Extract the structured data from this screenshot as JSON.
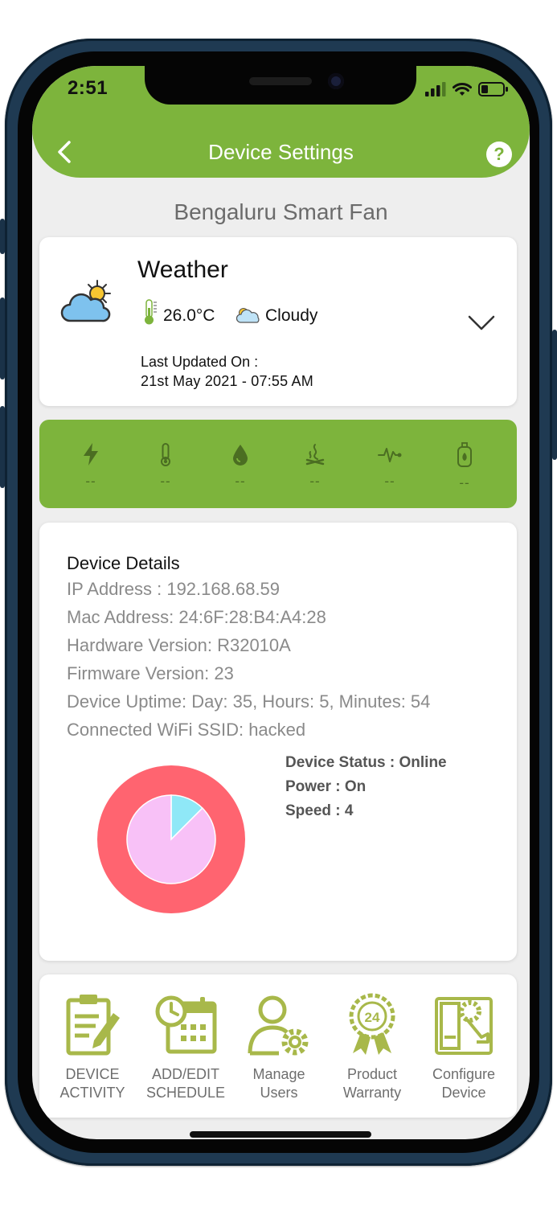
{
  "status_bar": {
    "time": "2:51"
  },
  "header": {
    "title": "Device Settings",
    "help_label": "?"
  },
  "device": {
    "name": "Bengaluru Smart Fan"
  },
  "weather": {
    "title": "Weather",
    "temperature": "26.0°C",
    "condition": "Cloudy",
    "last_updated_label": "Last Updated On :",
    "last_updated_value": "21st May 2021 - 07:55 AM"
  },
  "sensors": [
    {
      "icon": "bolt-icon",
      "value": "--"
    },
    {
      "icon": "thermometer-icon",
      "value": "--"
    },
    {
      "icon": "water-drop-icon",
      "value": "--"
    },
    {
      "icon": "smoke-icon",
      "value": "--"
    },
    {
      "icon": "pulse-icon",
      "value": "--"
    },
    {
      "icon": "gas-cylinder-icon",
      "value": "--"
    }
  ],
  "details": {
    "title": "Device Details",
    "lines": [
      "IP Address :  192.168.68.59",
      "Mac Address:  24:6F:28:B4:A4:28",
      "Hardware Version:   R32010A",
      "Firmware Version:   23",
      "Device Uptime:  Day: 35, Hours: 5, Minutes: 54",
      "Connected WiFi SSID:  hacked"
    ],
    "status": "Device Status : Online",
    "power": "Power : On",
    "speed": "Speed : 4"
  },
  "chart_data": {
    "type": "pie",
    "title": "",
    "inner_slices": [
      {
        "value": 12.5,
        "color": "#8fe8f7"
      },
      {
        "value": 87.5,
        "color": "#f8c1f7"
      }
    ],
    "outer_ring": {
      "value": 100,
      "color": "#ff6470"
    }
  },
  "actions": [
    {
      "line1": "DEVICE",
      "line2": "ACTIVITY",
      "icon": "clipboard-edit-icon"
    },
    {
      "line1": "ADD/EDIT",
      "line2": "SCHEDULE",
      "icon": "calendar-clock-icon"
    },
    {
      "line1": "Manage",
      "line2": "Users",
      "icon": "user-gear-icon"
    },
    {
      "line1": "Product",
      "line2": "Warranty",
      "icon": "warranty-badge-icon"
    },
    {
      "line1": "Configure",
      "line2": "Device",
      "icon": "configure-device-icon"
    }
  ],
  "colors": {
    "brand_green": "#7db43c",
    "icon_olive": "#a8b84a",
    "text_gray": "#8a8a8a"
  }
}
